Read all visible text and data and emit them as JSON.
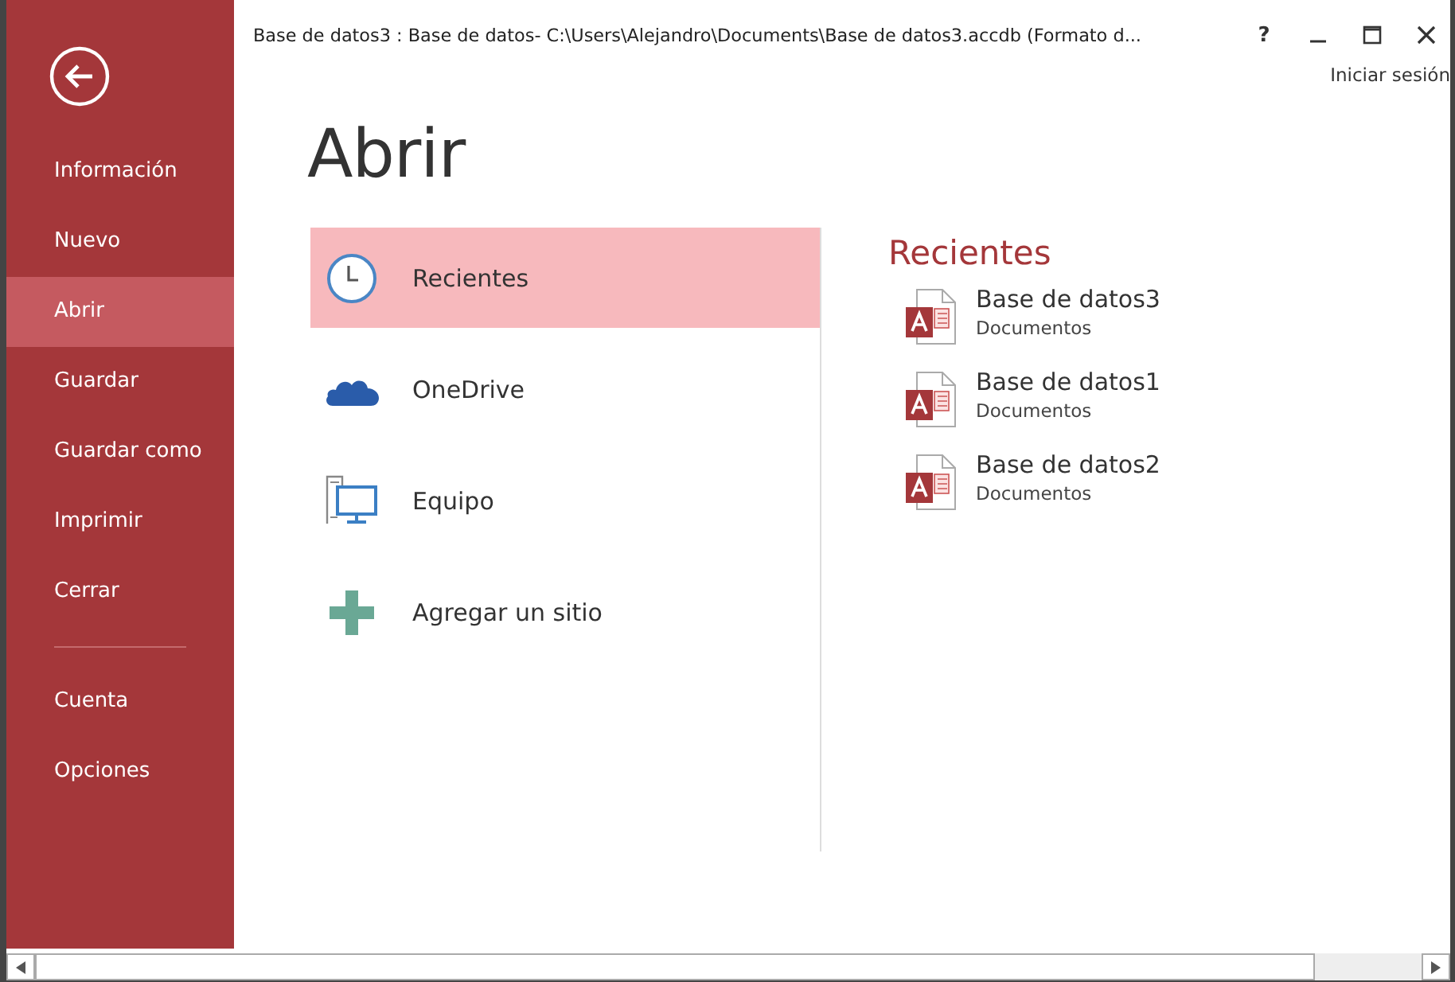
{
  "window": {
    "title": "Base de datos3 : Base de datos- C:\\Users\\Alejandro\\Documents\\Base de datos3.accdb (Formato d...",
    "help": "?",
    "sign_in": "Iniciar sesión"
  },
  "sidebar": {
    "items": [
      {
        "label": "Información",
        "selected": false
      },
      {
        "label": "Nuevo",
        "selected": false
      },
      {
        "label": "Abrir",
        "selected": true
      },
      {
        "label": "Guardar",
        "selected": false
      },
      {
        "label": "Guardar como",
        "selected": false
      },
      {
        "label": "Imprimir",
        "selected": false
      },
      {
        "label": "Cerrar",
        "selected": false
      }
    ],
    "bottom_items": [
      {
        "label": "Cuenta",
        "selected": false
      },
      {
        "label": "Opciones",
        "selected": false
      }
    ]
  },
  "page_title": "Abrir",
  "places": [
    {
      "kind": "clock",
      "label": "Recientes",
      "selected": true
    },
    {
      "kind": "cloud",
      "label": "OneDrive",
      "selected": false
    },
    {
      "kind": "computer",
      "label": "Equipo",
      "selected": false
    },
    {
      "kind": "add",
      "label": "Agregar un sitio",
      "selected": false
    }
  ],
  "recent": {
    "heading": "Recientes",
    "files": [
      {
        "name": "Base de datos3",
        "location": "Documentos"
      },
      {
        "name": "Base de datos1",
        "location": "Documentos"
      },
      {
        "name": "Base de datos2",
        "location": "Documentos"
      }
    ]
  }
}
